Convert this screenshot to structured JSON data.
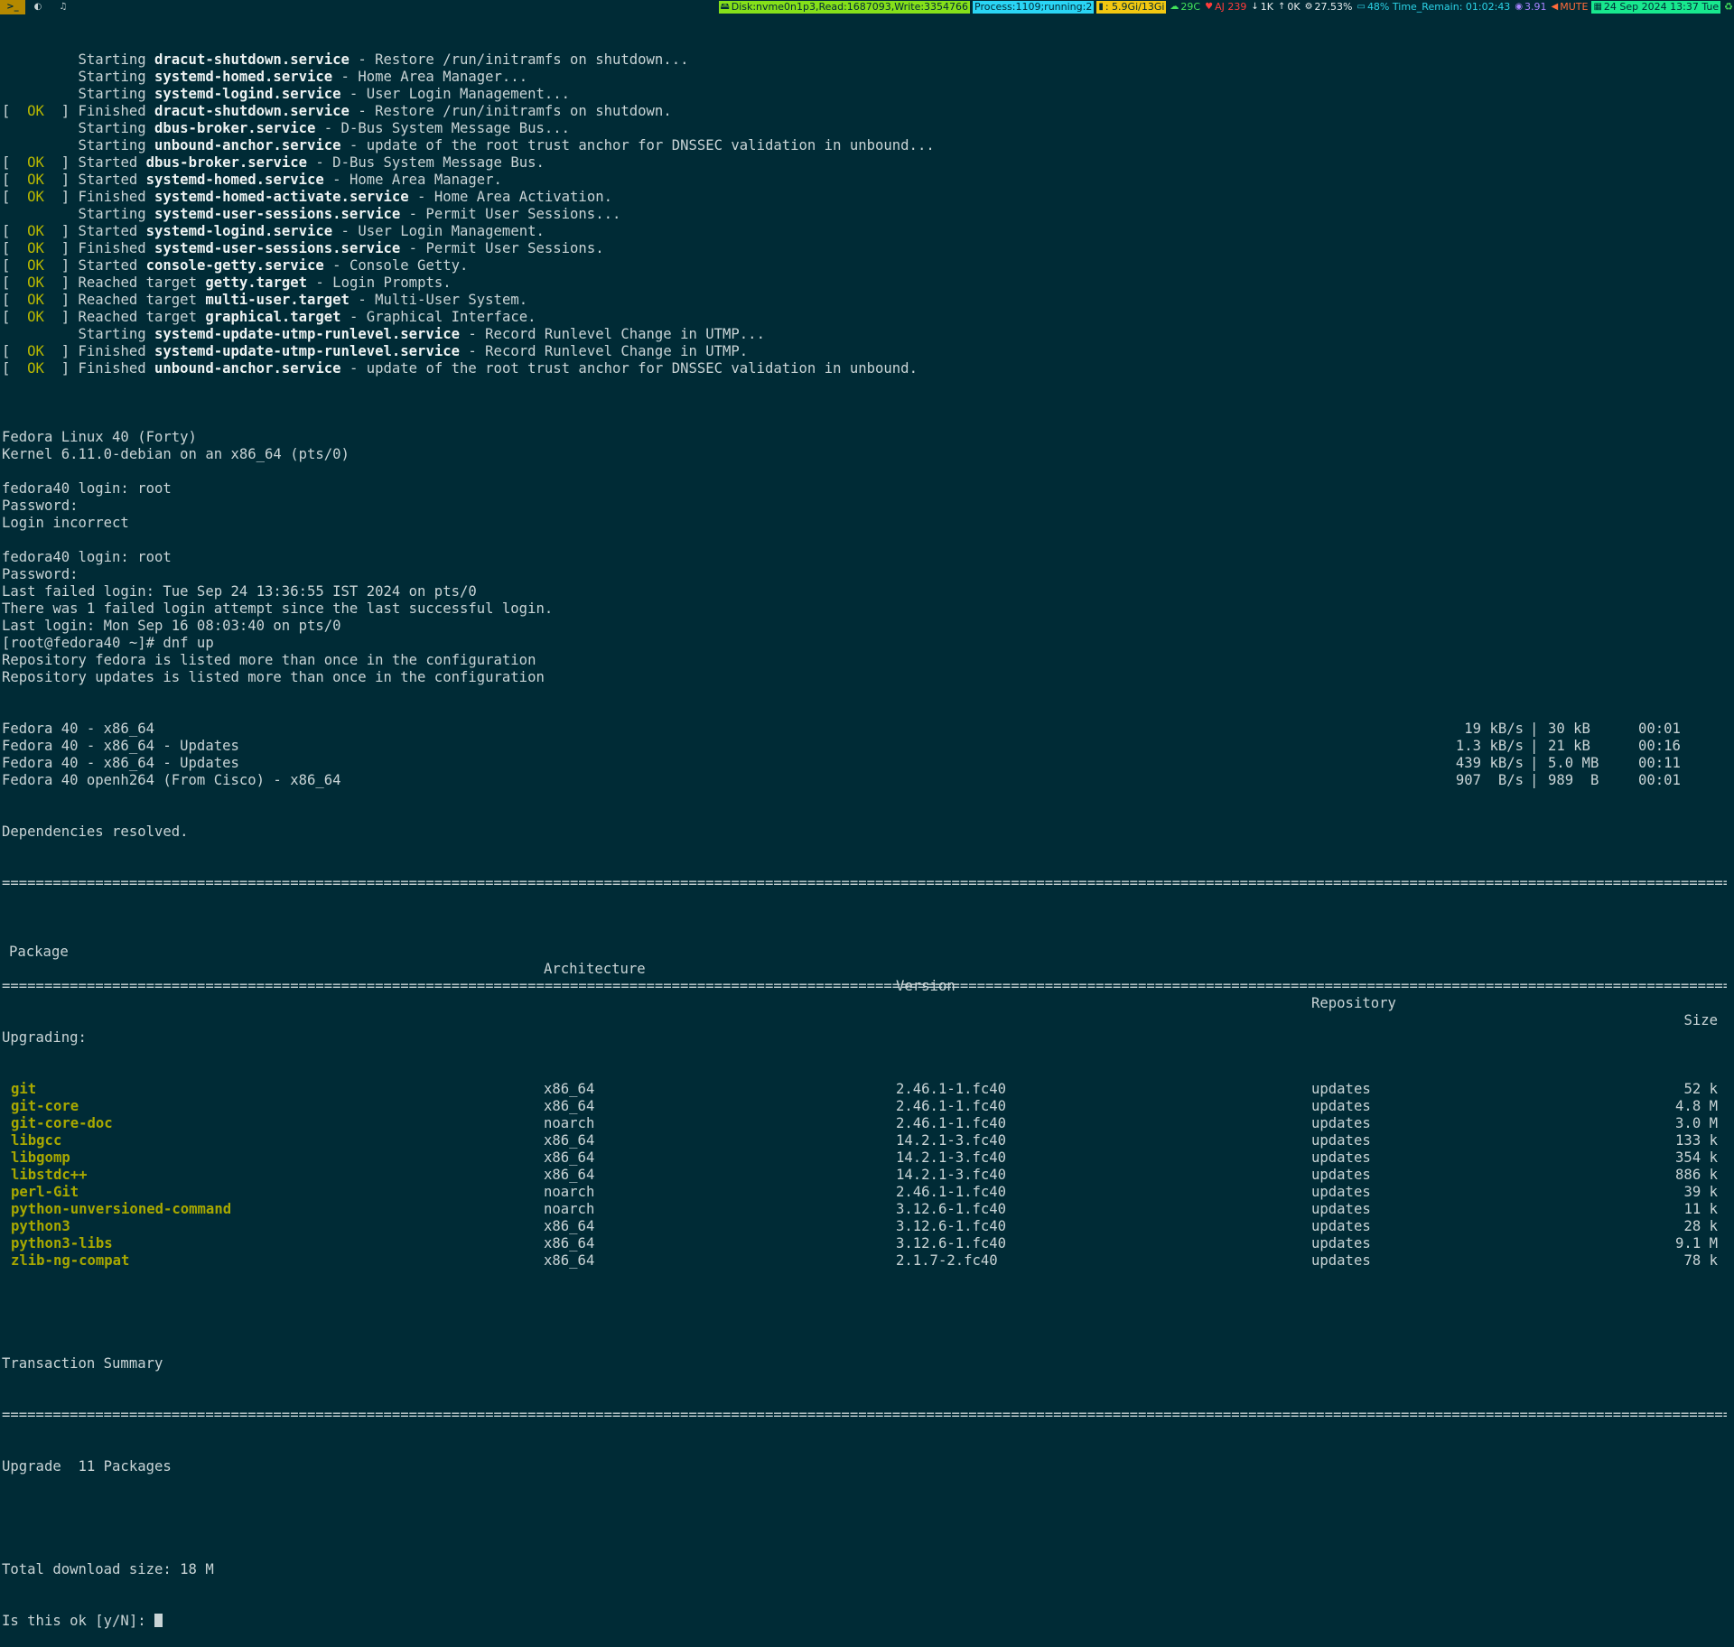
{
  "statusbar": {
    "workspaces": [
      {
        "glyph": ">_",
        "active": true
      },
      {
        "glyph": "◐",
        "active": false
      },
      {
        "glyph": "♫",
        "active": false
      }
    ],
    "disk": "Disk:nvme0n1p3,Read:1687093,Write:3354766",
    "process": "Process:1109;running:2",
    "memory": ": 5.9Gi/13Gi",
    "temp": "29C",
    "wifi": "AJ 239",
    "down": "1K",
    "up": "0K",
    "cpu": "27.53%",
    "battery": "48% Time_Remain: 01:02:43",
    "load": "3.91",
    "volume": "MUTE",
    "datetime": "24 Sep 2024 13:37 Tue",
    "colors": {
      "disk": "#85e01a",
      "process": "#2ad5f5",
      "memory": "#f2c811",
      "date": "#18e88e"
    }
  },
  "boot_log": [
    {
      "status": "",
      "verb": "Starting",
      "unit": "dracut-shutdown.service",
      "desc": " - Restore /run/initramfs on shutdown..."
    },
    {
      "status": "",
      "verb": "Starting",
      "unit": "systemd-homed.service",
      "desc": " - Home Area Manager..."
    },
    {
      "status": "",
      "verb": "Starting",
      "unit": "systemd-logind.service",
      "desc": " - User Login Management..."
    },
    {
      "status": "OK",
      "verb": "Finished",
      "unit": "dracut-shutdown.service",
      "desc": " - Restore /run/initramfs on shutdown."
    },
    {
      "status": "",
      "verb": "Starting",
      "unit": "dbus-broker.service",
      "desc": " - D-Bus System Message Bus..."
    },
    {
      "status": "",
      "verb": "Starting",
      "unit": "unbound-anchor.service",
      "desc": " - update of the root trust anchor for DNSSEC validation in unbound..."
    },
    {
      "status": "OK",
      "verb": "Started",
      "unit": "dbus-broker.service",
      "desc": " - D-Bus System Message Bus."
    },
    {
      "status": "OK",
      "verb": "Started",
      "unit": "systemd-homed.service",
      "desc": " - Home Area Manager."
    },
    {
      "status": "OK",
      "verb": "Finished",
      "unit": "systemd-homed-activate.service",
      "desc": " - Home Area Activation."
    },
    {
      "status": "",
      "verb": "Starting",
      "unit": "systemd-user-sessions.service",
      "desc": " - Permit User Sessions..."
    },
    {
      "status": "OK",
      "verb": "Started",
      "unit": "systemd-logind.service",
      "desc": " - User Login Management."
    },
    {
      "status": "OK",
      "verb": "Finished",
      "unit": "systemd-user-sessions.service",
      "desc": " - Permit User Sessions."
    },
    {
      "status": "OK",
      "verb": "Started",
      "unit": "console-getty.service",
      "desc": " - Console Getty."
    },
    {
      "status": "OK",
      "verb": "Reached target",
      "unit": "getty.target",
      "desc": " - Login Prompts."
    },
    {
      "status": "OK",
      "verb": "Reached target",
      "unit": "multi-user.target",
      "desc": " - Multi-User System."
    },
    {
      "status": "OK",
      "verb": "Reached target",
      "unit": "graphical.target",
      "desc": " - Graphical Interface."
    },
    {
      "status": "",
      "verb": "Starting",
      "unit": "systemd-update-utmp-runlevel.service",
      "desc": " - Record Runlevel Change in UTMP..."
    },
    {
      "status": "OK",
      "verb": "Finished",
      "unit": "systemd-update-utmp-runlevel.service",
      "desc": " - Record Runlevel Change in UTMP."
    },
    {
      "status": "OK",
      "verb": "Finished",
      "unit": "unbound-anchor.service",
      "desc": " - update of the root trust anchor for DNSSEC validation in unbound."
    }
  ],
  "session_lines": [
    "",
    "Fedora Linux 40 (Forty)",
    "Kernel 6.11.0-debian on an x86_64 (pts/0)",
    "",
    "fedora40 login: root",
    "Password:",
    "Login incorrect",
    "",
    "fedora40 login: root",
    "Password:",
    "Last failed login: Tue Sep 24 13:36:55 IST 2024 on pts/0",
    "There was 1 failed login attempt since the last successful login.",
    "Last login: Mon Sep 16 08:03:40 on pts/0",
    "[root@fedora40 ~]# dnf up",
    "Repository fedora is listed more than once in the configuration",
    "Repository updates is listed more than once in the configuration"
  ],
  "repos": [
    {
      "name": "Fedora 40 - x86_64",
      "rate": "19 kB/s",
      "size": "30 kB",
      "time": "00:01"
    },
    {
      "name": "Fedora 40 - x86_64 - Updates",
      "rate": "1.3 kB/s",
      "size": "21 kB",
      "time": "00:16"
    },
    {
      "name": "Fedora 40 - x86_64 - Updates",
      "rate": "439 kB/s",
      "size": "5.0 MB",
      "time": "00:11"
    },
    {
      "name": "Fedora 40 openh264 (From Cisco) - x86_64",
      "rate": "907  B/s",
      "size": "989  B",
      "time": "00:01"
    }
  ],
  "deps_resolved": "Dependencies resolved.",
  "table": {
    "headers": {
      "package": "Package",
      "arch": "Architecture",
      "version": "Version",
      "repo": "Repository",
      "size": "Size"
    },
    "group_label": "Upgrading:",
    "rows": [
      {
        "package": "git",
        "arch": "x86_64",
        "version": "2.46.1-1.fc40",
        "repo": "updates",
        "size": "52 k"
      },
      {
        "package": "git-core",
        "arch": "x86_64",
        "version": "2.46.1-1.fc40",
        "repo": "updates",
        "size": "4.8 M"
      },
      {
        "package": "git-core-doc",
        "arch": "noarch",
        "version": "2.46.1-1.fc40",
        "repo": "updates",
        "size": "3.0 M"
      },
      {
        "package": "libgcc",
        "arch": "x86_64",
        "version": "14.2.1-3.fc40",
        "repo": "updates",
        "size": "133 k"
      },
      {
        "package": "libgomp",
        "arch": "x86_64",
        "version": "14.2.1-3.fc40",
        "repo": "updates",
        "size": "354 k"
      },
      {
        "package": "libstdc++",
        "arch": "x86_64",
        "version": "14.2.1-3.fc40",
        "repo": "updates",
        "size": "886 k"
      },
      {
        "package": "perl-Git",
        "arch": "noarch",
        "version": "2.46.1-1.fc40",
        "repo": "updates",
        "size": "39 k"
      },
      {
        "package": "python-unversioned-command",
        "arch": "noarch",
        "version": "3.12.6-1.fc40",
        "repo": "updates",
        "size": "11 k"
      },
      {
        "package": "python3",
        "arch": "x86_64",
        "version": "3.12.6-1.fc40",
        "repo": "updates",
        "size": "28 k"
      },
      {
        "package": "python3-libs",
        "arch": "x86_64",
        "version": "3.12.6-1.fc40",
        "repo": "updates",
        "size": "9.1 M"
      },
      {
        "package": "zlib-ng-compat",
        "arch": "x86_64",
        "version": "2.1.7-2.fc40",
        "repo": "updates",
        "size": "78 k"
      }
    ]
  },
  "summary": {
    "title": "Transaction Summary",
    "upgrade": "Upgrade  11 Packages",
    "total": "Total download size: 18 M",
    "prompt": "Is this ok [y/N]: "
  }
}
